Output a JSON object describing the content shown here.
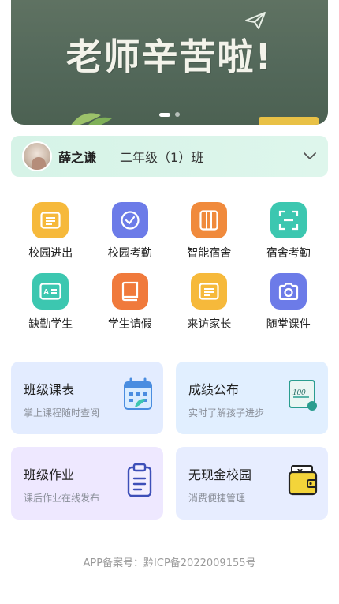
{
  "banner": {
    "title": "老师辛苦啦!",
    "accent_color": "#e9c146"
  },
  "class_selector": {
    "student_name": "薛之谦",
    "class_name": "二年级（1）班",
    "icon": "chevron-down-icon"
  },
  "menu": [
    {
      "label": "校园进出",
      "icon": "list-card-icon",
      "color": "#f6b93b"
    },
    {
      "label": "校园考勤",
      "icon": "check-circle-icon",
      "color": "#6c7be8"
    },
    {
      "label": "智能宿舍",
      "icon": "wardrobe-icon",
      "color": "#f08a3c"
    },
    {
      "label": "宿舍考勤",
      "icon": "scan-icon",
      "color": "#3cc7b0"
    },
    {
      "label": "缺勤学生",
      "icon": "id-card-icon",
      "color": "#3cc7b0"
    },
    {
      "label": "学生请假",
      "icon": "book-icon",
      "color": "#f07a3c"
    },
    {
      "label": "来访家长",
      "icon": "list-card-icon",
      "color": "#f6b93b"
    },
    {
      "label": "随堂课件",
      "icon": "camera-icon",
      "color": "#6c7be8"
    }
  ],
  "cards": [
    {
      "title": "班级课表",
      "subtitle": "掌上课程随时查阅",
      "icon": "calendar-icon",
      "bg": "#e3ecff"
    },
    {
      "title": "成绩公布",
      "subtitle": "实时了解孩子进步",
      "icon": "score-board-icon",
      "bg": "#e1efff"
    },
    {
      "title": "班级作业",
      "subtitle": "课后作业在线发布",
      "icon": "clipboard-icon",
      "bg": "#eee8ff"
    },
    {
      "title": "无现金校园",
      "subtitle": "消费便捷管理",
      "icon": "wallet-icon",
      "bg": "#e7edff"
    }
  ],
  "footer": {
    "icp_text": "APP备案号：黔ICP备2022009155号"
  }
}
